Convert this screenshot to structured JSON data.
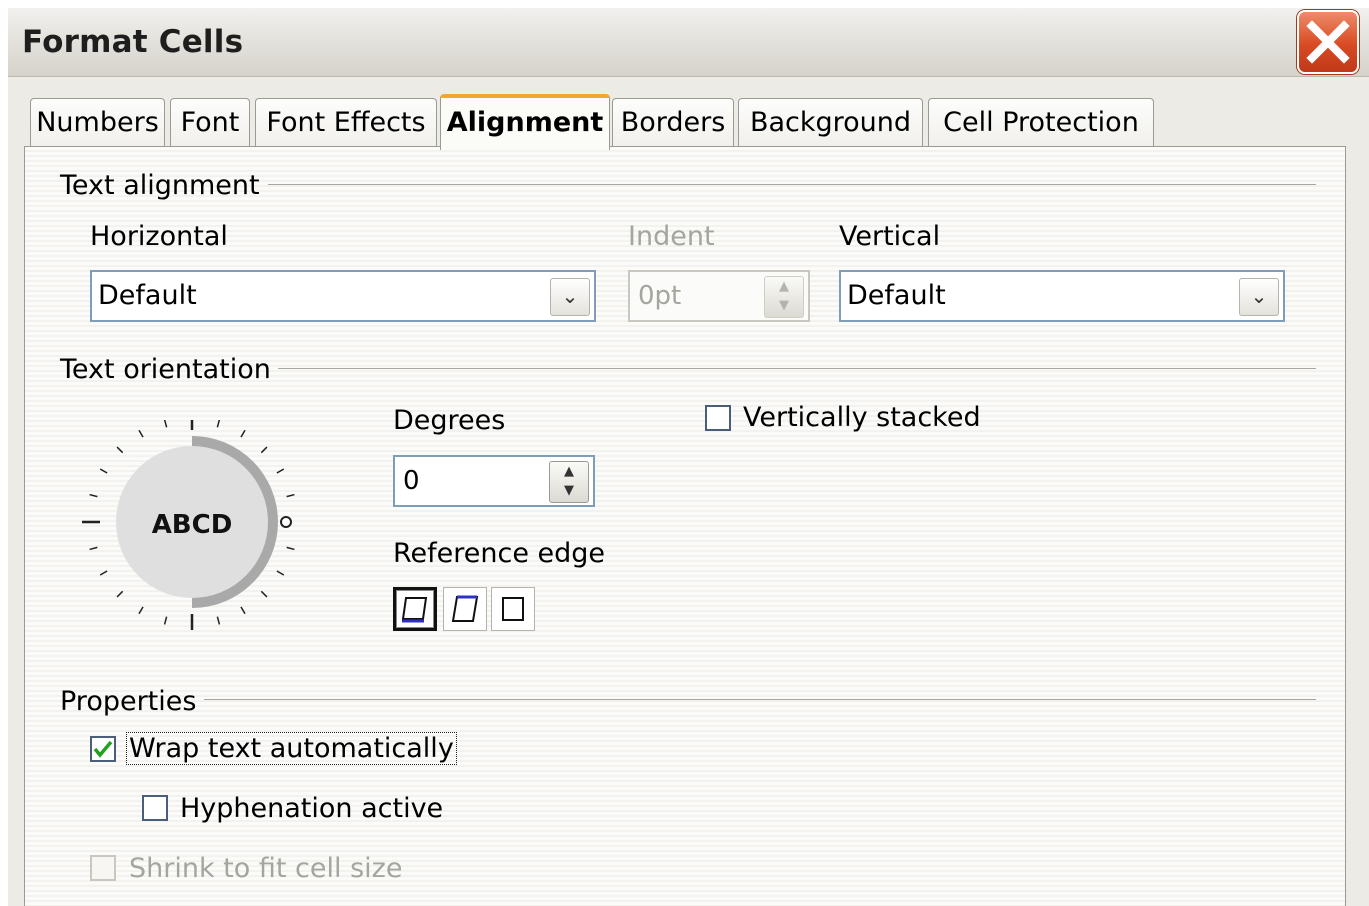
{
  "window": {
    "title": "Format Cells"
  },
  "tabs": [
    {
      "label": "Numbers",
      "active": false
    },
    {
      "label": "Font",
      "active": false
    },
    {
      "label": "Font Effects",
      "active": false
    },
    {
      "label": "Alignment",
      "active": true
    },
    {
      "label": "Borders",
      "active": false
    },
    {
      "label": "Background",
      "active": false
    },
    {
      "label": "Cell Protection",
      "active": false
    }
  ],
  "text_alignment": {
    "title": "Text alignment",
    "horizontal": {
      "label": "Horizontal",
      "value": "Default"
    },
    "indent": {
      "label": "Indent",
      "value": "0pt",
      "disabled": true
    },
    "vertical": {
      "label": "Vertical",
      "value": "Default"
    }
  },
  "text_orientation": {
    "title": "Text orientation",
    "dial_text": "ABCD",
    "degrees": {
      "label": "Degrees",
      "value": "0"
    },
    "vertically_stacked": {
      "label": "Vertically stacked",
      "checked": false
    },
    "reference_edge": {
      "label": "Reference edge",
      "selected": 0
    }
  },
  "properties": {
    "title": "Properties",
    "wrap": {
      "label": "Wrap text automatically",
      "checked": true
    },
    "hyphenation": {
      "label": "Hyphenation active",
      "checked": false
    },
    "shrink": {
      "label": "Shrink to fit cell size",
      "checked": false,
      "disabled": true
    }
  },
  "colors": {
    "accent_tab": "#f3a733",
    "check_green": "#21a121",
    "edge_blue": "#2f2fc8"
  }
}
